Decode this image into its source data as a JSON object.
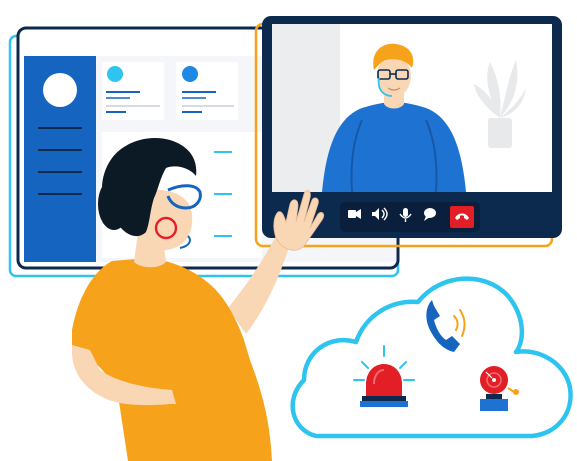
{
  "colors": {
    "primary_blue": "#1565C0",
    "cyan_accent": "#2EC4F0",
    "orange_accent": "#F7A21B",
    "dark_navy": "#0C2A4D",
    "alert_red": "#E21F26",
    "skin": "#F9D7B5"
  },
  "icons": {
    "camera": "video-camera-icon",
    "volume": "speaker-volume-icon",
    "mic": "microphone-icon",
    "chat": "chat-bubble-icon",
    "end_call": "hang-up-phone-icon",
    "phone": "ringing-phone-icon",
    "siren": "alarm-siren-icon",
    "bell": "alarm-bell-icon"
  },
  "video_call": {
    "controls": [
      "camera",
      "volume",
      "mic",
      "chat",
      "end_call"
    ]
  }
}
